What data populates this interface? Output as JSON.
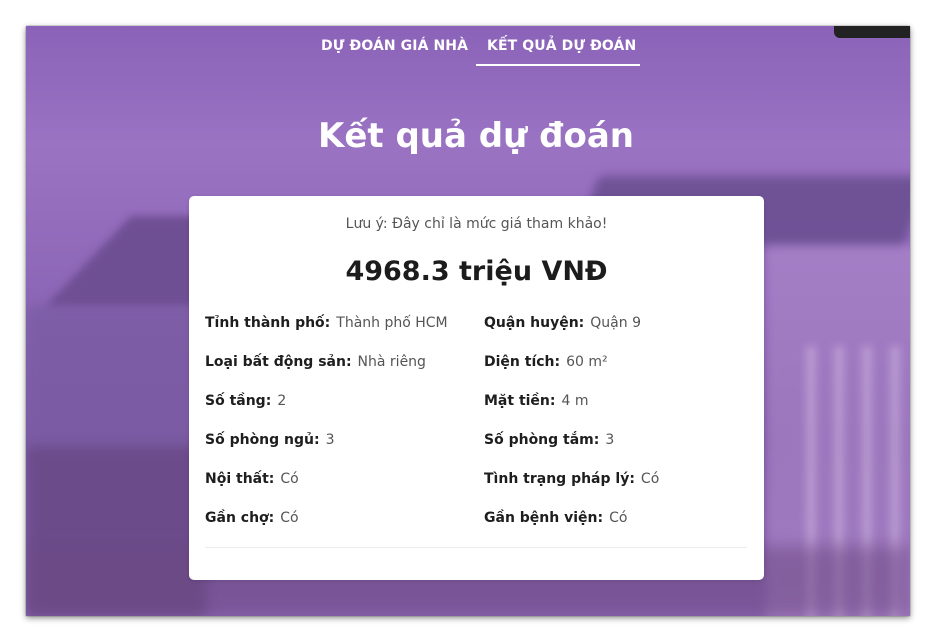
{
  "nav": {
    "items": [
      {
        "label": "DỰ ĐOÁN GIÁ NHÀ"
      },
      {
        "label": "KẾT QUẢ DỰ ĐOÁN"
      }
    ]
  },
  "page": {
    "title": "Kết quả dự đoán"
  },
  "result": {
    "note": "Lưu ý: Đây chỉ là mức giá tham khảo!",
    "price": "4968.3 triệu VNĐ",
    "fields": [
      {
        "label": "Tỉnh thành phố:",
        "value": "Thành phố HCM"
      },
      {
        "label": "Quận huyện:",
        "value": "Quận 9"
      },
      {
        "label": "Loại bất động sản:",
        "value": "Nhà riêng"
      },
      {
        "label": "Diện tích:",
        "value": "60 m²"
      },
      {
        "label": "Số tầng:",
        "value": "2"
      },
      {
        "label": "Mặt tiền:",
        "value": "4 m"
      },
      {
        "label": "Số phòng ngủ:",
        "value": "3"
      },
      {
        "label": "Số phòng tắm:",
        "value": "3"
      },
      {
        "label": "Nội thất:",
        "value": "Có"
      },
      {
        "label": "Tình trạng pháp lý:",
        "value": "Có"
      },
      {
        "label": "Gần chợ:",
        "value": "Có"
      },
      {
        "label": "Gần bệnh viện:",
        "value": "Có"
      }
    ]
  }
}
